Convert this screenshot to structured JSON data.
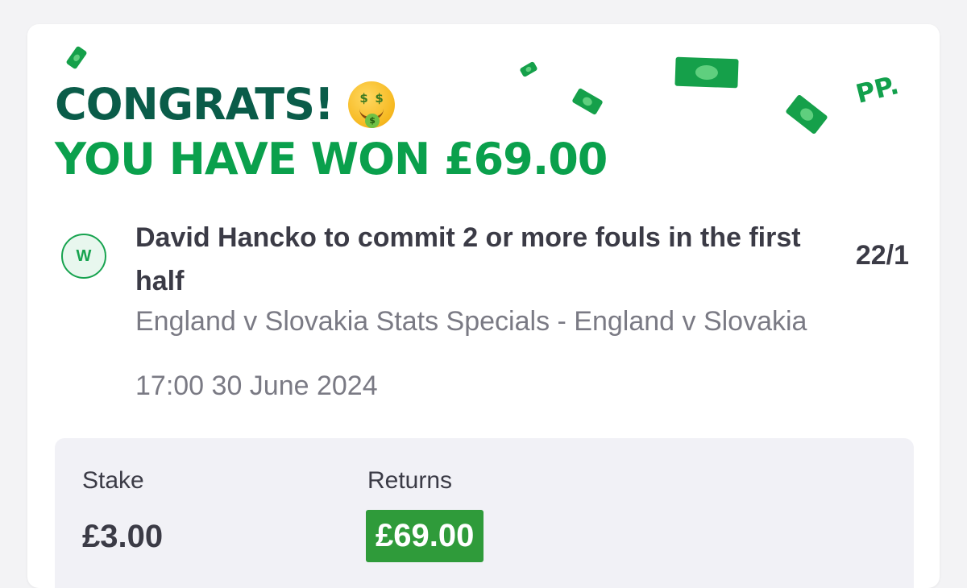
{
  "header": {
    "line1": "CONGRATS!",
    "line2": "YOU HAVE WON £69.00",
    "emoji": "money-mouth-face-icon",
    "brand_mark": "PP."
  },
  "selection": {
    "status_badge": "W",
    "title": "David Hancko to commit 2 or more fouls in the first half",
    "odds": "22/1",
    "market": "England v Slovakia Stats Specials - England v Slovakia",
    "datetime": "17:00 30 June 2024"
  },
  "summary": {
    "stake_label": "Stake",
    "stake_value": "£3.00",
    "returns_label": "Returns",
    "returns_value": "£69.00"
  },
  "colors": {
    "dark_green": "#0a5c49",
    "bright_green": "#0aa04c",
    "returns_bg": "#2f9b3a",
    "text_dark": "#3b3b46",
    "text_muted": "#7a7a84"
  }
}
